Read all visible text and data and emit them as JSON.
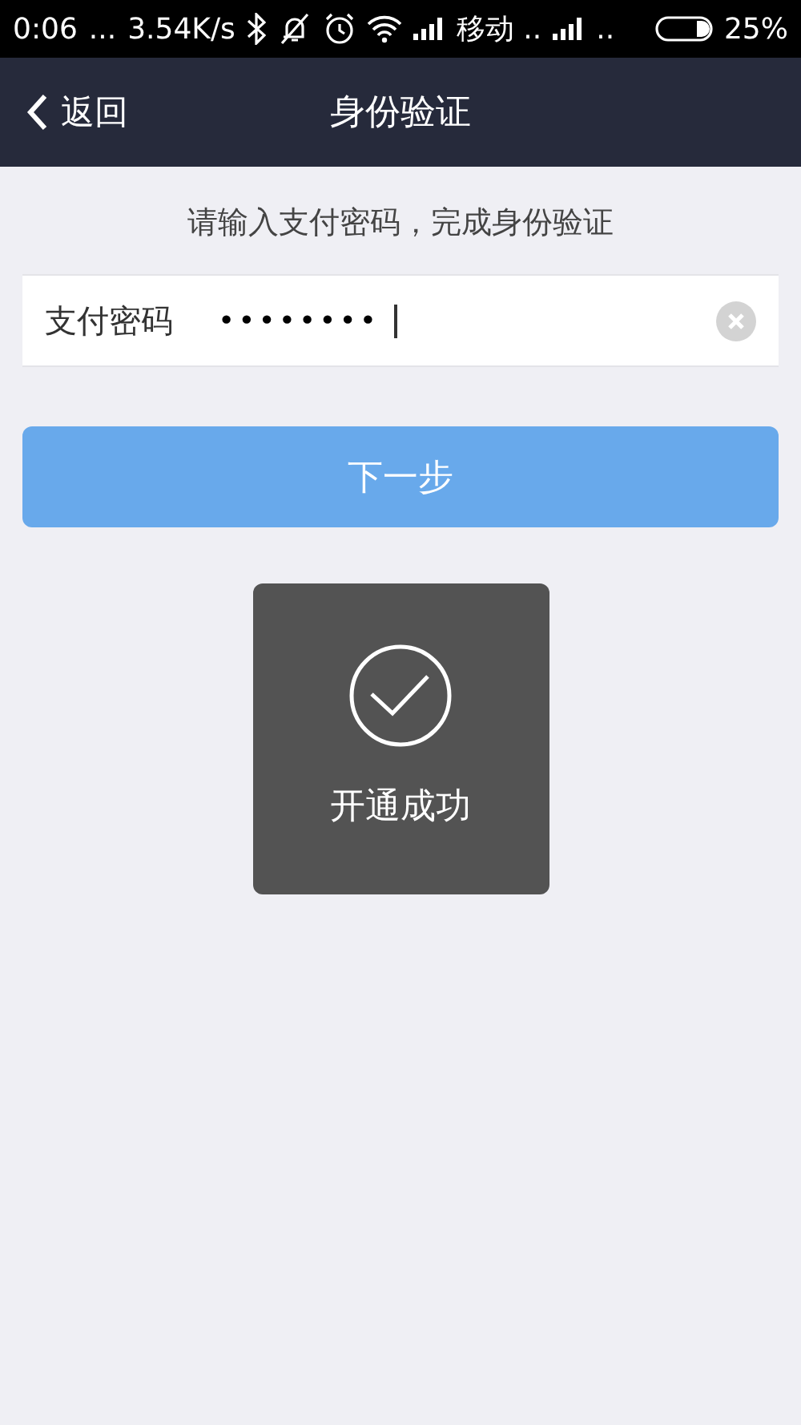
{
  "status_bar": {
    "time": "0:06",
    "dots": "...",
    "speed": "3.54K/s",
    "carrier": "移动 ..",
    "carrier2": "..",
    "battery": "25%"
  },
  "nav": {
    "back": "返回",
    "title": "身份验证"
  },
  "prompt": "请输入支付密码，完成身份验证",
  "password_field": {
    "label": "支付密码",
    "value": "••••••••",
    "focused": true
  },
  "next_button": {
    "label": "下一步",
    "disabled": true
  },
  "toast": {
    "message": "开通成功"
  }
}
